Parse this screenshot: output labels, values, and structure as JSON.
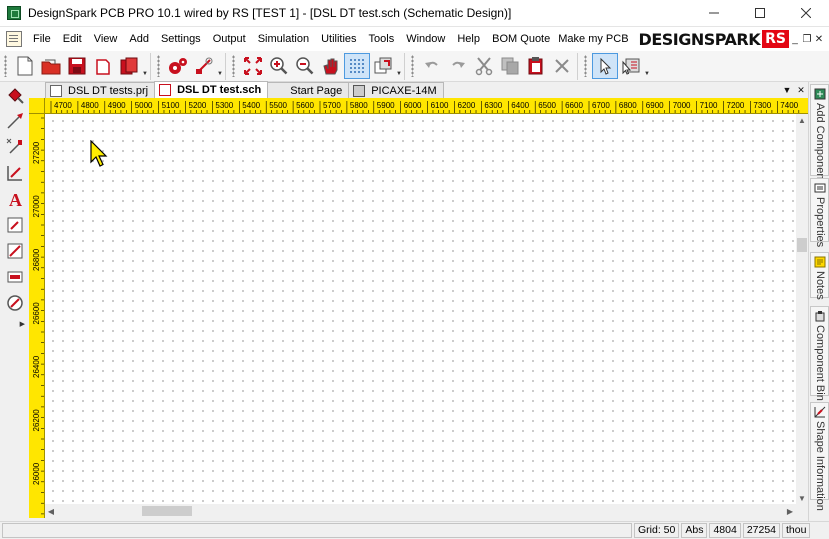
{
  "window": {
    "title": "DesignSpark PCB PRO 10.1 wired by RS [TEST 1] - [DSL DT test.sch (Schematic Design)]",
    "minimize": "minimize",
    "maximize": "maximize",
    "close": "close"
  },
  "menu": {
    "items": [
      "File",
      "Edit",
      "View",
      "Add",
      "Settings",
      "Output",
      "Simulation",
      "Utilities",
      "Tools",
      "Window",
      "Help"
    ],
    "bom_quote": "BOM Quote",
    "make_pcb": "Make my PCB",
    "brand": "DESIGNSPARK",
    "brand_badge": "RS",
    "mdi_min": "_",
    "mdi_restore": "❐",
    "mdi_close": "✕"
  },
  "tabs": [
    {
      "label": "DSL DT tests.prj",
      "active": false
    },
    {
      "label": "DSL DT test.sch",
      "active": true
    },
    {
      "label": "Start Page",
      "active": false
    },
    {
      "label": "PICAXE-14M",
      "active": false
    }
  ],
  "tab_controls": {
    "dropdown": "▼",
    "close": "✕"
  },
  "ruler": {
    "horizontal": [
      "4700",
      "4800",
      "4900",
      "5000",
      "5100",
      "5200",
      "5300",
      "5400",
      "5500",
      "5600",
      "5700",
      "5800",
      "5900",
      "6000",
      "6100",
      "6200",
      "6300",
      "6400",
      "6500",
      "6600",
      "6700",
      "6800",
      "6900",
      "7000",
      "7100",
      "7200",
      "7300",
      "7400"
    ],
    "vertical": [
      "27200",
      "27000",
      "26800",
      "26600",
      "26400",
      "26200",
      "26000"
    ]
  },
  "side_panels": [
    "Add Component",
    "Properties",
    "Notes",
    "Component Bin",
    "Shape Information"
  ],
  "status": {
    "grid": "Grid: 50",
    "abs": "Abs",
    "x": "4804",
    "y": "27254",
    "units": "thou"
  },
  "colors": {
    "ruler": "#ffe600",
    "accent_red": "#e30613",
    "cursor": "#ffee00"
  }
}
